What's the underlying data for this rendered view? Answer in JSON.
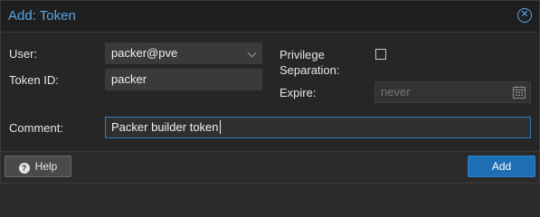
{
  "window": {
    "title": "Add: Token",
    "close_icon": "close-circle-icon"
  },
  "form": {
    "user": {
      "label": "User:",
      "value": "packer@pve"
    },
    "token_id": {
      "label": "Token ID:",
      "value": "packer"
    },
    "privilege": {
      "label_line1": "Privilege",
      "label_line2": "Separation:",
      "checked": false
    },
    "expire": {
      "label": "Expire:",
      "placeholder": "never",
      "icon": "calendar-icon"
    },
    "comment": {
      "label": "Comment:",
      "value": "Packer builder token"
    }
  },
  "footer": {
    "help_label": "Help",
    "help_icon": "question-circle-icon",
    "add_label": "Add"
  },
  "colors": {
    "accent": "#5aa6e6",
    "primary_button": "#1f6fb5",
    "focus_border": "#2d7fc5"
  }
}
